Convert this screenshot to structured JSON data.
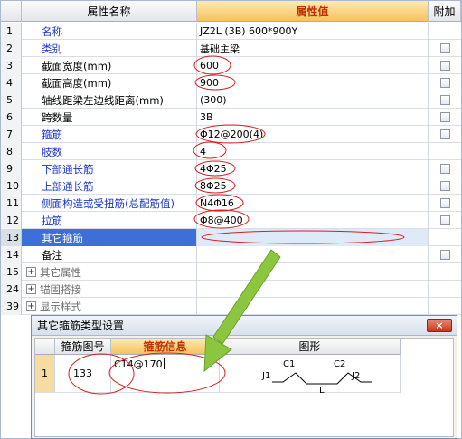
{
  "grid": {
    "headers": {
      "name": "属性名称",
      "value": "属性值",
      "add": "附加"
    },
    "rows": [
      {
        "num": "1",
        "name": "名称",
        "value": "JZ2L (3B) 600*900Y",
        "blue": true,
        "checkbox": false
      },
      {
        "num": "2",
        "name": "类别",
        "value": "基础主梁",
        "blue": true,
        "checkbox": true
      },
      {
        "num": "3",
        "name": "截面宽度(mm)",
        "value": "600",
        "blue": false,
        "checkbox": true
      },
      {
        "num": "4",
        "name": "截面高度(mm)",
        "value": "900",
        "blue": false,
        "checkbox": true
      },
      {
        "num": "5",
        "name": "轴线距梁左边线距离(mm)",
        "value": "(300)",
        "blue": false,
        "checkbox": true
      },
      {
        "num": "6",
        "name": "跨数量",
        "value": "3B",
        "blue": false,
        "checkbox": true
      },
      {
        "num": "7",
        "name": "箍筋",
        "value": "Φ12@200(4)",
        "blue": true,
        "checkbox": true
      },
      {
        "num": "8",
        "name": "肢数",
        "value": "4",
        "blue": true,
        "checkbox": false
      },
      {
        "num": "9",
        "name": "下部通长筋",
        "value": "4Φ25",
        "blue": true,
        "checkbox": true
      },
      {
        "num": "10",
        "name": "上部通长筋",
        "value": "8Φ25",
        "blue": true,
        "checkbox": true
      },
      {
        "num": "11",
        "name": "侧面构造或受扭筋(总配筋值)",
        "value": "N4Φ16",
        "blue": true,
        "checkbox": true
      },
      {
        "num": "12",
        "name": "拉筋",
        "value": "Φ8@400",
        "blue": true,
        "checkbox": true
      },
      {
        "num": "13",
        "name": "其它箍筋",
        "value": "",
        "blue": false,
        "checkbox": false,
        "selected": true
      },
      {
        "num": "14",
        "name": "备注",
        "value": "",
        "blue": false,
        "checkbox": true
      }
    ],
    "groups": [
      {
        "num": "15",
        "name": "其它属性",
        "expander": "+"
      },
      {
        "num": "24",
        "name": "锚固搭接",
        "expander": "+"
      },
      {
        "num": "39",
        "name": "显示样式",
        "expander": "+"
      }
    ]
  },
  "dialog": {
    "title": "其它箍筋类型设置",
    "close": "×",
    "headers": {
      "col1": "箍筋图号",
      "col2": "箍筋信息",
      "col3": "图形"
    },
    "row": {
      "num": "1",
      "figure_no": "133",
      "info": "C14@170",
      "shape_labels": {
        "c1": "C1",
        "c2": "C2",
        "j1": "J1",
        "j2": "J2",
        "l": "L"
      }
    }
  },
  "colors": {
    "annotation_red": "#d81e1e",
    "arrow_green": "#8cc63e",
    "selection_blue": "#3d6fd6",
    "header_orange": "#f6c25e"
  }
}
